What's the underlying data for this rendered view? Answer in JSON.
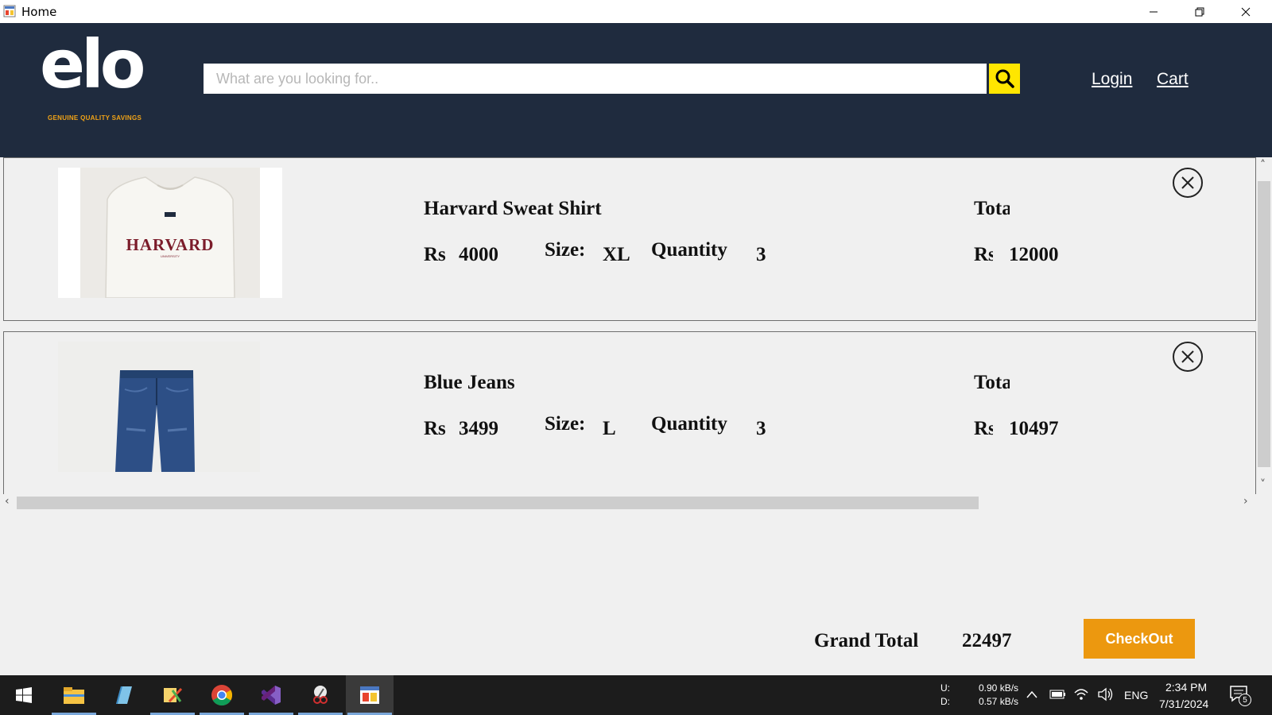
{
  "window": {
    "title": "Home"
  },
  "header": {
    "logo_text": "elo",
    "logo_tagline": "GENUINE QUALITY SAVINGS",
    "search_placeholder": "What are you looking for..",
    "login_label": "Login",
    "cart_label": "Cart"
  },
  "cart": {
    "items": [
      {
        "name": "Harvard Sweat Shirt",
        "currency": "Rs",
        "price": "4000",
        "size_label": "Size:",
        "size": "XL",
        "quantity_label": "Quantity",
        "quantity": "3",
        "total_label": "Total",
        "total_currency": "Rs",
        "total": "12000"
      },
      {
        "name": "Blue Jeans",
        "currency": "Rs",
        "price": "3499",
        "size_label": "Size:",
        "size": "L",
        "quantity_label": "Quantity",
        "quantity": "3",
        "total_label": "Total",
        "total_currency": "Rs",
        "total": "10497"
      }
    ]
  },
  "footer": {
    "grand_total_label": "Grand Total",
    "grand_total_value": "22497",
    "checkout_label": "CheckOut"
  },
  "taskbar": {
    "net_up_label": "U:",
    "net_down_label": "D:",
    "net_up": "0.90 kB/s",
    "net_down": "0.57 kB/s",
    "language": "ENG",
    "time": "2:34 PM",
    "date": "7/31/2024",
    "notifications": "5"
  },
  "colors": {
    "header_bg": "#1f2b3e",
    "search_button": "#ffe600",
    "checkout_button": "#ec980f",
    "logo_tagline": "#f1a316"
  }
}
